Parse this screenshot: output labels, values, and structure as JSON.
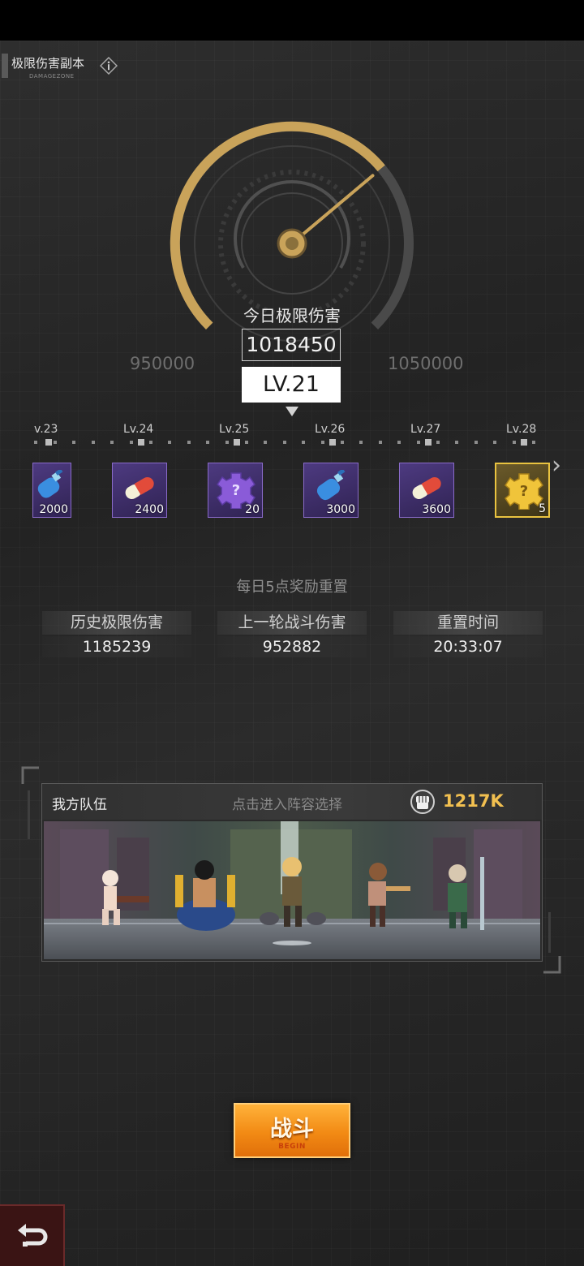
{
  "header": {
    "title": "极限伤害副本",
    "subtitle": "DAMAGEZONE",
    "info_icon": "info-icon"
  },
  "gauge": {
    "label": "今日极限伤害",
    "value": "1018450",
    "range_min": "950000",
    "range_max": "1050000",
    "level": "LV.21",
    "progress": 0.685,
    "accent_color": "#c9a35a"
  },
  "level_track": {
    "labels": [
      "v.23",
      "Lv.24",
      "Lv.25",
      "Lv.26",
      "Lv.27",
      "Lv.28"
    ],
    "next_icon": "double-chevron-right-icon"
  },
  "rewards": [
    {
      "icon": "water-bottle-icon",
      "qty": "2000",
      "rarity": "purple"
    },
    {
      "icon": "capsule-pill-icon",
      "qty": "2400",
      "rarity": "purple"
    },
    {
      "icon": "mystery-gear-icon",
      "qty": "20",
      "rarity": "purple"
    },
    {
      "icon": "water-bottle-icon",
      "qty": "3000",
      "rarity": "purple"
    },
    {
      "icon": "capsule-pill-icon",
      "qty": "3600",
      "rarity": "purple"
    },
    {
      "icon": "mystery-gear-icon",
      "qty": "5",
      "rarity": "gold"
    }
  ],
  "reset_note": "每日5点奖励重置",
  "stats": {
    "best": {
      "label": "历史极限伤害",
      "value": "1185239"
    },
    "last": {
      "label": "上一轮战斗伤害",
      "value": "952882"
    },
    "reset": {
      "label": "重置时间",
      "value": "20:33:07"
    }
  },
  "team": {
    "title": "我方队伍",
    "hint": "点击进入阵容选择",
    "power_icon": "fist-icon",
    "power": "1217K",
    "power_color": "#f2c050"
  },
  "actions": {
    "fight_label": "战斗",
    "fight_sub": "BEGIN",
    "back_icon": "return-arrow-icon"
  }
}
